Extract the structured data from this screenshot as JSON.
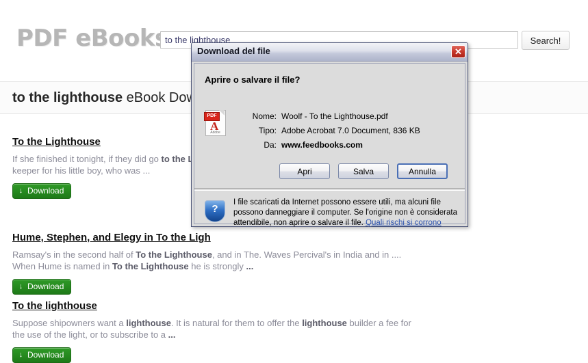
{
  "site": {
    "logo": "PDF eBooks",
    "search": {
      "value": "to the lighthouse",
      "placeholder": "",
      "button_label": "Search!"
    },
    "page_heading_query": "to the lighthouse",
    "page_heading_rest": "eBook Downl"
  },
  "results": [
    {
      "title": "To the Lighthouse",
      "snippet_html": "If she finished it tonight, if they did go <b>to the Ligh</b>",
      "snippet_line2": "keeper for his little boy, who was ...",
      "download_label": "Download",
      "download_icon": "down-arrow-icon"
    },
    {
      "title": "Hume, Stephen, and Elegy in To the Ligh",
      "snippet_html": "Ramsay's in the second half of <b>To the Lighthouse</b>, and in The. Waves Percival's in India and in ....",
      "snippet_line2": "When Hume is named in <b>To the Lighthouse</b> he is strongly <b>...</b>",
      "download_label": "Download",
      "download_icon": "down-arrow-icon"
    },
    {
      "title": "To the lighthouse",
      "snippet_html": "Suppose shipowners want a <b>lighthouse</b>. It is natural for them to offer the <b>lighthouse</b> builder a fee for",
      "snippet_line2": "the use of the light, or to subscribe to a <b>...</b>",
      "download_label": "Download",
      "download_icon": "down-arrow-icon"
    }
  ],
  "dialog": {
    "title": "Download del file",
    "close_glyph": "✕",
    "question": "Aprire o salvare il file?",
    "file_icon": "pdf-file-icon",
    "pdf_tab_label": "PDF",
    "pdf_letter": "A",
    "pdf_adobe_label": "Adobe",
    "fields": [
      {
        "label": "Nome:",
        "value": "Woolf - To the Lighthouse.pdf",
        "bold": false
      },
      {
        "label": "Tipo:",
        "value": "Adobe Acrobat 7.0 Document, 836 KB",
        "bold": false
      },
      {
        "label": "Da:",
        "value": "www.feedbooks.com",
        "bold": true
      }
    ],
    "buttons": {
      "open": "Apri",
      "save": "Salva",
      "cancel": "Annulla"
    },
    "warning": {
      "icon": "shield-question-icon",
      "shield_glyph": "?",
      "text": "I file scaricati da Internet possono essere utili, ma alcuni file possono danneggiare il computer. Se l'origine non è considerata attendibile, non aprire o salvare il file.",
      "link": "Quali rischi si corrono"
    }
  },
  "colors": {
    "accent_green": "#1e7a18",
    "dialog_red": "#c9392c",
    "dialog_blue": "#2f6fc4",
    "link_blue": "#2f55b0"
  }
}
